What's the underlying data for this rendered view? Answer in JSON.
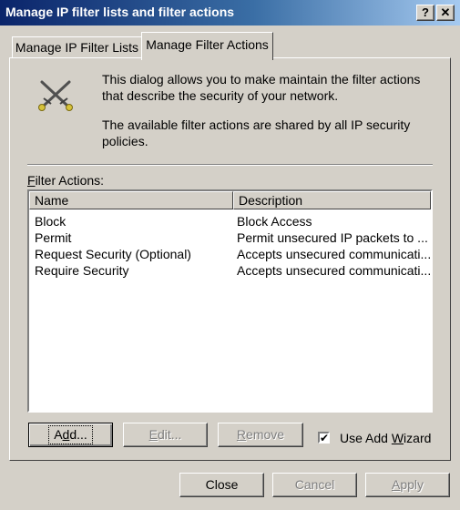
{
  "window": {
    "title": "Manage IP filter lists and filter actions",
    "help_glyph": "?",
    "close_glyph": "✕"
  },
  "tabs": [
    {
      "label": "Manage IP Filter Lists",
      "active": false
    },
    {
      "label": "Manage Filter Actions",
      "active": true
    }
  ],
  "panel": {
    "icon": "crossed-swords-icon",
    "description1": "This dialog allows you to make maintain the filter actions that describe the security of your network.",
    "description2": "The available filter actions are shared by all IP security policies.",
    "list_label_accel": "F",
    "list_label_rest": "ilter Actions:",
    "columns": [
      "Name",
      "Description"
    ],
    "rows": [
      {
        "name": "Block",
        "description": "Block Access"
      },
      {
        "name": "Permit",
        "description": "Permit unsecured IP packets to ..."
      },
      {
        "name": "Request Security (Optional)",
        "description": "Accepts unsecured communicati..."
      },
      {
        "name": "Require Security",
        "description": "Accepts unsecured communicati..."
      }
    ],
    "buttons": {
      "add": {
        "pre": "A",
        "accel": "d",
        "post": "d..."
      },
      "edit": {
        "pre": "",
        "accel": "E",
        "post": "dit..."
      },
      "remove": {
        "pre": "",
        "accel": "R",
        "post": "emove"
      }
    },
    "wizard": {
      "pre": "Use Add ",
      "accel": "W",
      "post": "izard",
      "checked": true,
      "check_glyph": "✔"
    }
  },
  "footer": {
    "close": "Close",
    "cancel": "Cancel",
    "apply_accel": "A",
    "apply_rest": "pply"
  },
  "colors": {
    "face": "#d4d0c8",
    "title_start": "#0a246a",
    "title_end": "#a6caf0"
  }
}
